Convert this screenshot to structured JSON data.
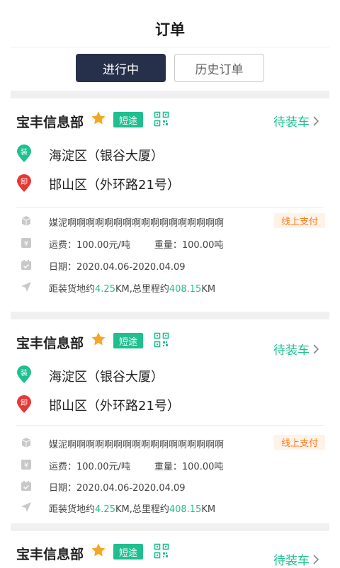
{
  "header": {
    "title": "订单"
  },
  "tabs": [
    {
      "label": "进行中",
      "active": true
    },
    {
      "label": "历史订单",
      "active": false
    }
  ],
  "colors": {
    "accent": "#1fbf8f",
    "tab_active_bg": "#27304a",
    "star": "#f5a623",
    "unload_pin": "#e53935",
    "pay_text": "#ff7a22",
    "pay_bg": "#fff2e6"
  },
  "orders": [
    {
      "company": "宝丰信息部",
      "badge": "短途",
      "status": "待装车",
      "load_pin": "装",
      "load_address": "海淀区（银谷大厦）",
      "unload_pin": "卸",
      "unload_address": "邯山区（外环路21号）",
      "cargo": "媒泥啊啊啊啊啊啊啊啊啊啊啊啊啊啊啊啊啊",
      "payment": "线上支付",
      "freight": "运费：100.00元/吨",
      "weight": "重量：100.00吨",
      "date": "日期：2020.04.06-2020.04.09",
      "distance_prefix": "距装货地约",
      "distance_km": "4.25",
      "distance_mid": "KM,总里程约",
      "total_km": "408.15",
      "distance_suffix": "KM"
    },
    {
      "company": "宝丰信息部",
      "badge": "短途",
      "status": "待装车",
      "load_pin": "装",
      "load_address": "海淀区（银谷大厦）",
      "unload_pin": "卸",
      "unload_address": "邯山区（外环路21号）",
      "cargo": "媒泥啊啊啊啊啊啊啊啊啊啊啊啊啊啊啊啊啊",
      "payment": "线上支付",
      "freight": "运费：100.00元/吨",
      "weight": "重量：100.00吨",
      "date": "日期：2020.04.06-2020.04.09",
      "distance_prefix": "距装货地约",
      "distance_km": "4.25",
      "distance_mid": "KM,总里程约",
      "total_km": "408.15",
      "distance_suffix": "KM"
    },
    {
      "company": "宝丰信息部",
      "badge": "短途",
      "status": "待装车"
    }
  ]
}
